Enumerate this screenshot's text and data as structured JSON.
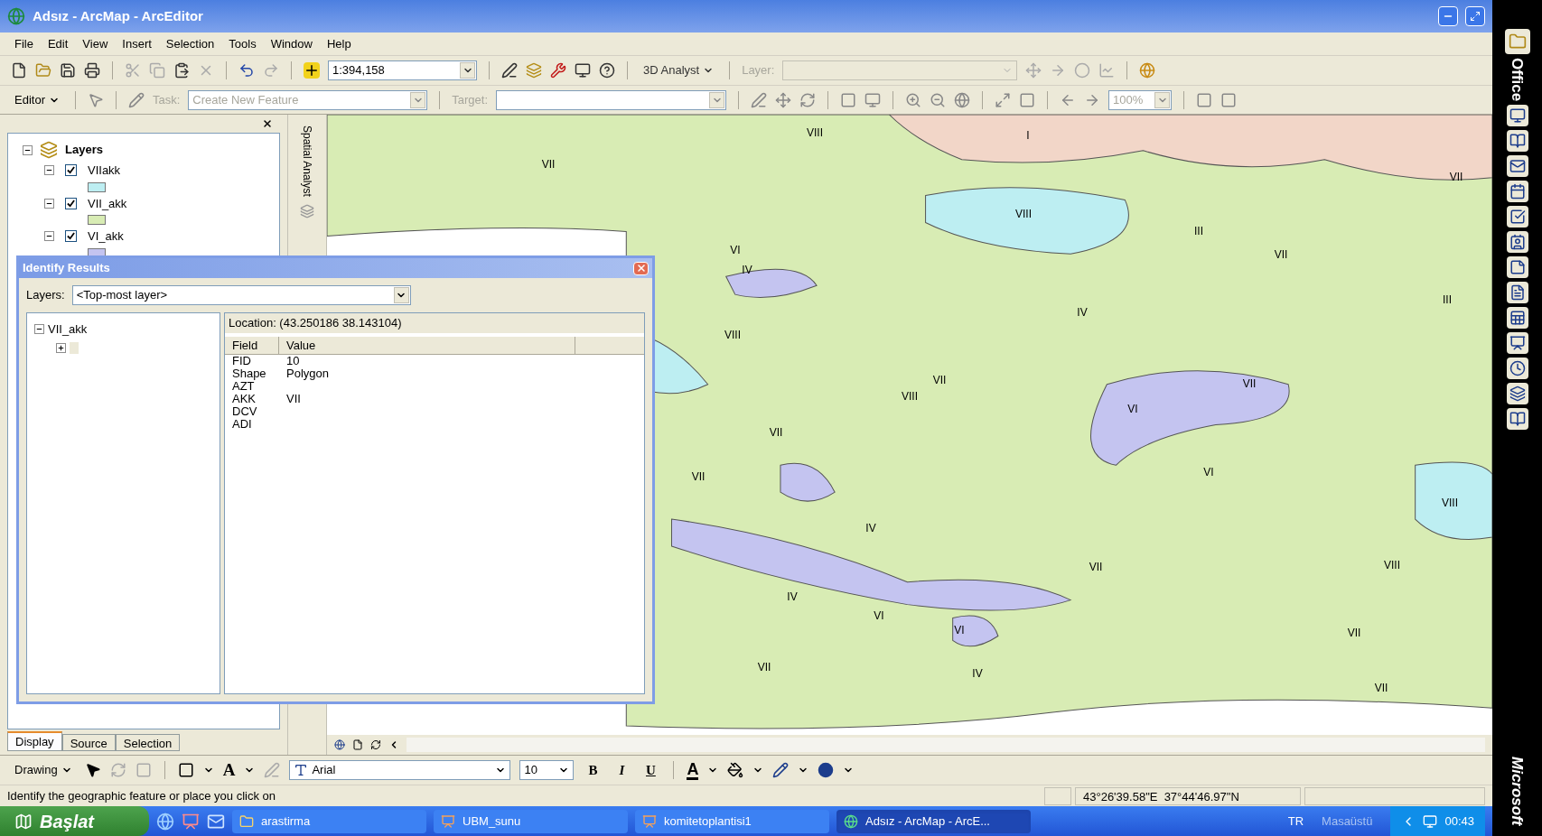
{
  "window": {
    "title": "Adsız - ArcMap - ArcEditor"
  },
  "menu": [
    "File",
    "Edit",
    "View",
    "Insert",
    "Selection",
    "Tools",
    "Window",
    "Help"
  ],
  "standard_toolbar": {
    "scale": "1:394,158",
    "analyst_menu": "3D Analyst",
    "layer_label": "Layer:"
  },
  "editor_toolbar": {
    "editor_menu": "Editor",
    "task_label": "Task:",
    "task_value": "Create New Feature",
    "target_label": "Target:",
    "zoom_value": "100%"
  },
  "toc": {
    "root": "Layers",
    "layers": [
      {
        "name": "VIIakk",
        "checked": true,
        "color": "#bdeef2"
      },
      {
        "name": "VII_akk",
        "checked": true,
        "color": "#d8ecb4"
      },
      {
        "name": "VI_akk",
        "checked": true,
        "color": "#c4c4f0"
      }
    ]
  },
  "side_toolbar": {
    "title": "Spatial Analyst"
  },
  "toc_tabs": [
    {
      "label": "Display",
      "selected": true
    },
    {
      "label": "Source",
      "selected": false
    },
    {
      "label": "Selection",
      "selected": false
    }
  ],
  "identify": {
    "title": "Identify Results",
    "layers_label": "Layers:",
    "layers_value": "<Top-most layer>",
    "tree": [
      {
        "label": "VII_akk",
        "expanded": true,
        "children": [
          {
            "expanded": false
          }
        ]
      }
    ],
    "location": "Location: (43.250186 38.143104)",
    "columns": [
      "Field",
      "Value"
    ],
    "rows": [
      [
        "FID",
        "10"
      ],
      [
        "Shape",
        "Polygon"
      ],
      [
        "AZT",
        ""
      ],
      [
        "AKK",
        "VII"
      ],
      [
        "DCV",
        ""
      ],
      [
        "ADI",
        ""
      ]
    ]
  },
  "map": {
    "labels": [
      "VIII",
      "I",
      "VII",
      "VII",
      "VIII",
      "III",
      "VI",
      "VII",
      "IV",
      "III",
      "IV",
      "VIII",
      "VII",
      "VII",
      "VIII",
      "VI",
      "VII",
      "VI",
      "VII",
      "VIII",
      "IV",
      "VIII",
      "VII",
      "IV",
      "VI",
      "VI",
      "VII",
      "VII",
      "IV",
      "VII"
    ]
  },
  "drawing_toolbar": {
    "menu": "Drawing",
    "text_tool": "A",
    "font": "Arial",
    "size": "10",
    "format_buttons": [
      "B",
      "I",
      "U"
    ],
    "font_color": "A"
  },
  "status_bar": {
    "message": "Identify the geographic feature or place you click on",
    "coordinates": "43°26'39.58\"E  37°44'46.97\"N"
  },
  "taskbar": {
    "start": "Başlat",
    "tasks": [
      {
        "label": "arastirma",
        "kind": "folder",
        "selected": false
      },
      {
        "label": "UBM_sunu",
        "kind": "slides",
        "selected": false
      },
      {
        "label": "komitetoplantisi1",
        "kind": "slides",
        "selected": false
      },
      {
        "label": "Adsız - ArcMap - ArcE...",
        "kind": "globe",
        "selected": true
      }
    ],
    "language": "TR",
    "desktop": "Masaüstü",
    "clock": "00:43"
  },
  "office_bar": {
    "title": "Office",
    "footer": "Microsoft"
  }
}
